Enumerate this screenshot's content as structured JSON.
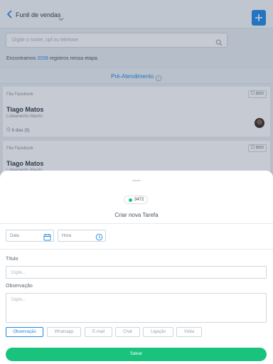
{
  "header": {
    "title": "Funil de vendas"
  },
  "search": {
    "placeholder": "Digite o nome, cpf ou telefone"
  },
  "results": {
    "prefix": "Encontramos",
    "count": "2039",
    "suffix": "registros nessa etapa."
  },
  "stage": {
    "name": "Pré-Atendimento"
  },
  "cards": [
    {
      "queue": "Fila Facebook",
      "badge": "3520",
      "name": "Tiago Matos",
      "sub": "Loteamento Aberto",
      "days": "8 dias (5)"
    },
    {
      "queue": "Fila Facebook",
      "badge": "3520",
      "name": "Tiago Matos",
      "sub": "Loteamento Aberto"
    }
  ],
  "sheet": {
    "id": "3472",
    "title": "Criar nova Tarefa",
    "date_placeholder": "Data",
    "time_placeholder": "Hora",
    "titulo_label": "Título",
    "titulo_placeholder": "Digite...",
    "obs_label": "Observação",
    "obs_placeholder": "Digite...",
    "types": [
      "Observação",
      "Whatsapp",
      "E-mail",
      "Chat",
      "Ligação",
      "Visita"
    ],
    "active_type": "Observação",
    "save_label": "Salvar"
  },
  "colors": {
    "primary": "#1e88e5",
    "success": "#19c37d",
    "background": "#e9edf2"
  }
}
